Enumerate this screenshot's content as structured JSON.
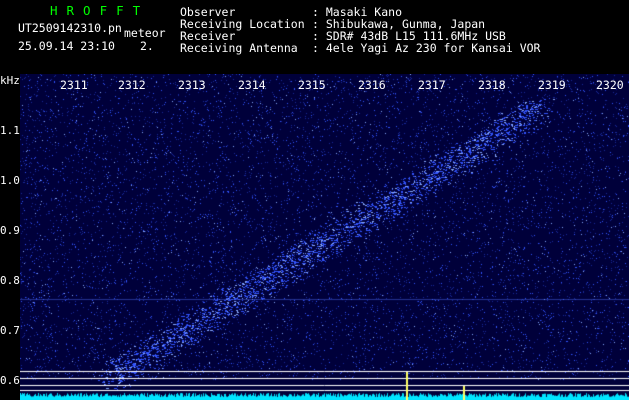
{
  "header": {
    "brand": "HROFFT",
    "filename": "UT2509142310.pn",
    "sub_label": "meteor",
    "datetime": "25.09.14 23:10",
    "count": "2.",
    "fields": [
      {
        "label": "Observer",
        "value": ": Masaki Kano"
      },
      {
        "label": "Receiving Location",
        "value": ": Shibukawa, Gunma, Japan"
      },
      {
        "label": "Receiver",
        "value": ": SDR# 43dB L15 111.6MHz USB"
      },
      {
        "label": "Receiving Antenna",
        "value": ": 4ele Yagi Az 230 for Kansai VOR"
      }
    ]
  },
  "spectrogram": {
    "y_unit": "kHz",
    "y_ticks": [
      "1.1",
      "1.0",
      "0.9",
      "0.8",
      "0.7",
      "0.6"
    ],
    "x_ticks": [
      "2311",
      "2312",
      "2313",
      "2314",
      "2315",
      "2316",
      "2317",
      "2318",
      "2319",
      "2320"
    ],
    "colors": {
      "background": "#00003a",
      "signal": "#3355ff",
      "bright": "#88aaff",
      "baseline": "#00e5ff",
      "grid": "#ffffff"
    }
  }
}
